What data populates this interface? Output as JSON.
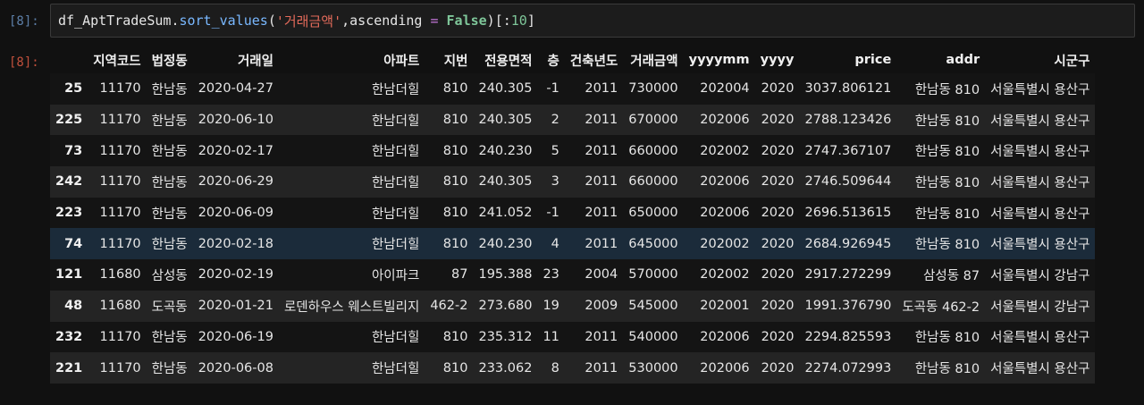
{
  "cell": {
    "in_prompt": "[8]:",
    "out_prompt": "[8]:",
    "code": {
      "var": "df_AptTradeSum",
      "dot": ".",
      "fn": "sort_values",
      "open": "(",
      "str": "'거래금액'",
      "comma": ", ",
      "kwarg": "ascending",
      "eq": " = ",
      "bool": "False",
      "close": ")[:",
      "num": "10",
      "end": "]"
    }
  },
  "table": {
    "columns": [
      "",
      "지역코드",
      "법정동",
      "거래일",
      "아파트",
      "지번",
      "전용면적",
      "층",
      "건축년도",
      "거래금액",
      "yyyymm",
      "yyyy",
      "price",
      "addr",
      "시군구"
    ],
    "highlighted_row": 5,
    "rows": [
      [
        "25",
        "11170",
        "한남동",
        "2020-04-27",
        "한남더힐",
        "810",
        "240.305",
        "-1",
        "2011",
        "730000",
        "202004",
        "2020",
        "3037.806121",
        "한남동 810",
        "서울특별시 용산구"
      ],
      [
        "225",
        "11170",
        "한남동",
        "2020-06-10",
        "한남더힐",
        "810",
        "240.305",
        "2",
        "2011",
        "670000",
        "202006",
        "2020",
        "2788.123426",
        "한남동 810",
        "서울특별시 용산구"
      ],
      [
        "73",
        "11170",
        "한남동",
        "2020-02-17",
        "한남더힐",
        "810",
        "240.230",
        "5",
        "2011",
        "660000",
        "202002",
        "2020",
        "2747.367107",
        "한남동 810",
        "서울특별시 용산구"
      ],
      [
        "242",
        "11170",
        "한남동",
        "2020-06-29",
        "한남더힐",
        "810",
        "240.305",
        "3",
        "2011",
        "660000",
        "202006",
        "2020",
        "2746.509644",
        "한남동 810",
        "서울특별시 용산구"
      ],
      [
        "223",
        "11170",
        "한남동",
        "2020-06-09",
        "한남더힐",
        "810",
        "241.052",
        "-1",
        "2011",
        "650000",
        "202006",
        "2020",
        "2696.513615",
        "한남동 810",
        "서울특별시 용산구"
      ],
      [
        "74",
        "11170",
        "한남동",
        "2020-02-18",
        "한남더힐",
        "810",
        "240.230",
        "4",
        "2011",
        "645000",
        "202002",
        "2020",
        "2684.926945",
        "한남동 810",
        "서울특별시 용산구"
      ],
      [
        "121",
        "11680",
        "삼성동",
        "2020-02-19",
        "아이파크",
        "87",
        "195.388",
        "23",
        "2004",
        "570000",
        "202002",
        "2020",
        "2917.272299",
        "삼성동 87",
        "서울특별시 강남구"
      ],
      [
        "48",
        "11680",
        "도곡동",
        "2020-01-21",
        "로덴하우스 웨스트빌리지",
        "462-2",
        "273.680",
        "19",
        "2009",
        "545000",
        "202001",
        "2020",
        "1991.376790",
        "도곡동 462-2",
        "서울특별시 강남구"
      ],
      [
        "232",
        "11170",
        "한남동",
        "2020-06-19",
        "한남더힐",
        "810",
        "235.312",
        "11",
        "2011",
        "540000",
        "202006",
        "2020",
        "2294.825593",
        "한남동 810",
        "서울특별시 용산구"
      ],
      [
        "221",
        "11170",
        "한남동",
        "2020-06-08",
        "한남더힐",
        "810",
        "233.062",
        "8",
        "2011",
        "530000",
        "202006",
        "2020",
        "2274.072993",
        "한남동 810",
        "서울특별시 용산구"
      ]
    ]
  }
}
